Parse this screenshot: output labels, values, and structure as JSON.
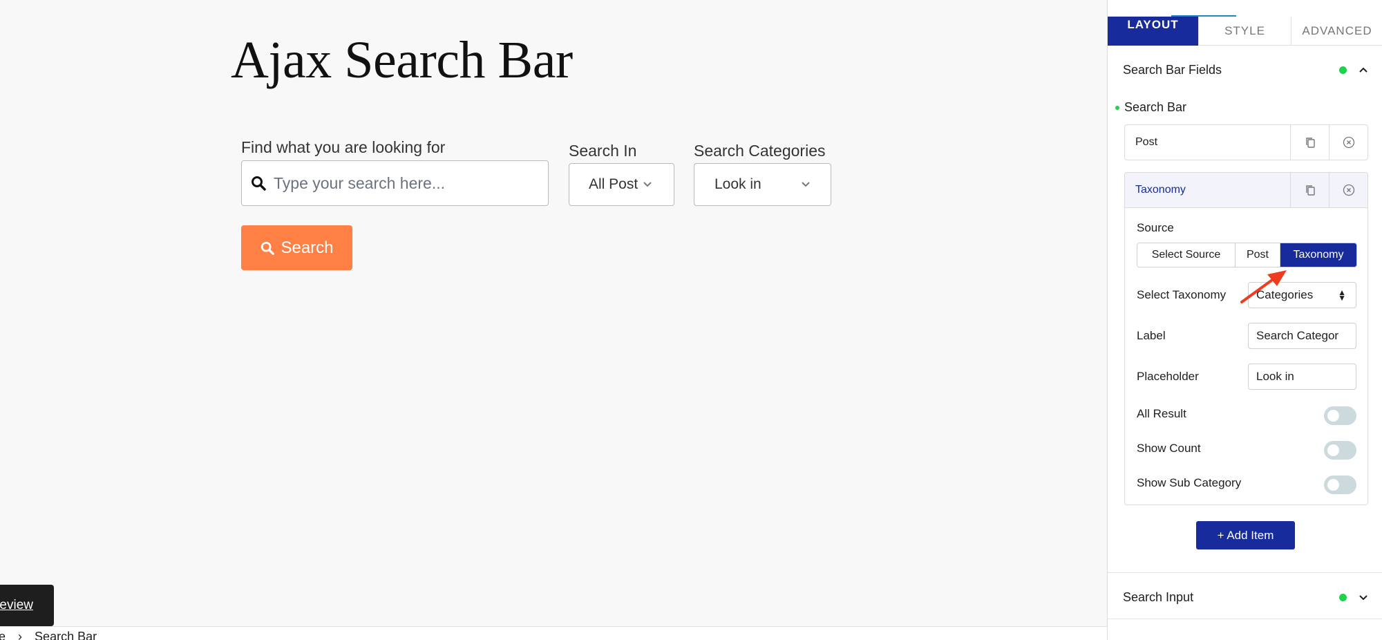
{
  "canvas": {
    "title": "Ajax Search Bar",
    "search_field": {
      "label": "Find what you are looking for",
      "placeholder": "Type your search here...",
      "icon": "search-icon"
    },
    "search_in": {
      "label": "Search In",
      "selected": "All Post",
      "icon": "chevron-down-icon"
    },
    "search_categories": {
      "label": "Search Categories",
      "selected": "Look in",
      "icon": "chevron-down-icon"
    },
    "search_button": {
      "label": "Search",
      "icon": "search-icon",
      "color": "#ff8044"
    },
    "preview_button": "eview",
    "breadcrumb": [
      "age",
      "Search Bar"
    ],
    "breadcrumb_separator": "›"
  },
  "panel": {
    "tabs": [
      {
        "label": "LAYOUT",
        "active": true
      },
      {
        "label": "STYLE",
        "active": false
      },
      {
        "label": "ADVANCED",
        "active": false
      }
    ],
    "accent_color": "#172b9c",
    "status_dot_color": "#1ed24b",
    "sections": {
      "search_bar_fields": {
        "title": "Search Bar Fields",
        "expanded": true,
        "sub_label": "Search Bar",
        "items": [
          {
            "title": "Post",
            "expanded": false
          },
          {
            "title": "Taxonomy",
            "expanded": true
          }
        ],
        "taxonomy_settings": {
          "source_label": "Source",
          "source_options": [
            "Select Source",
            "Post",
            "Taxonomy"
          ],
          "source_selected": "Taxonomy",
          "select_taxonomy_label": "Select Taxonomy",
          "select_taxonomy_value": "Categories",
          "label_label": "Label",
          "label_value": "Search Categor",
          "placeholder_label": "Placeholder",
          "placeholder_value": "Look in",
          "toggles": [
            {
              "label": "All Result",
              "on": false
            },
            {
              "label": "Show Count",
              "on": false
            },
            {
              "label": "Show Sub Category",
              "on": false
            }
          ]
        },
        "add_item_label": "+ Add Item"
      },
      "search_input": {
        "title": "Search Input",
        "expanded": false
      }
    }
  }
}
